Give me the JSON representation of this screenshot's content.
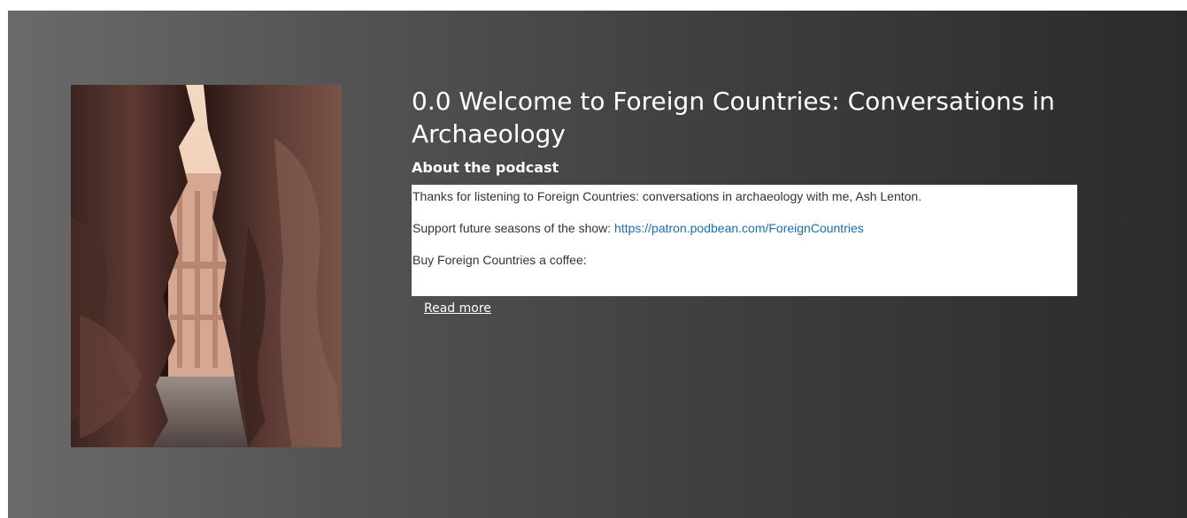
{
  "podcast": {
    "episode_title": "0.0 Welcome to Foreign Countries: Conversations in Archaeology",
    "about_heading": "About the podcast",
    "description": {
      "line1": "Thanks for listening to Foreign Countries: conversations in archaeology with me, Ash Lenton.",
      "line2_prefix": "Support future seasons of the show: ",
      "line2_link": "https://patron.podbean.com/ForeignCountries",
      "line3": "Buy Foreign Countries a coffee:"
    },
    "read_more": "Read more"
  },
  "colors": {
    "title_text": "#ffffff",
    "link": "#1a6fb0",
    "description_text": "#333333",
    "panel_bg": "#ffffff"
  }
}
